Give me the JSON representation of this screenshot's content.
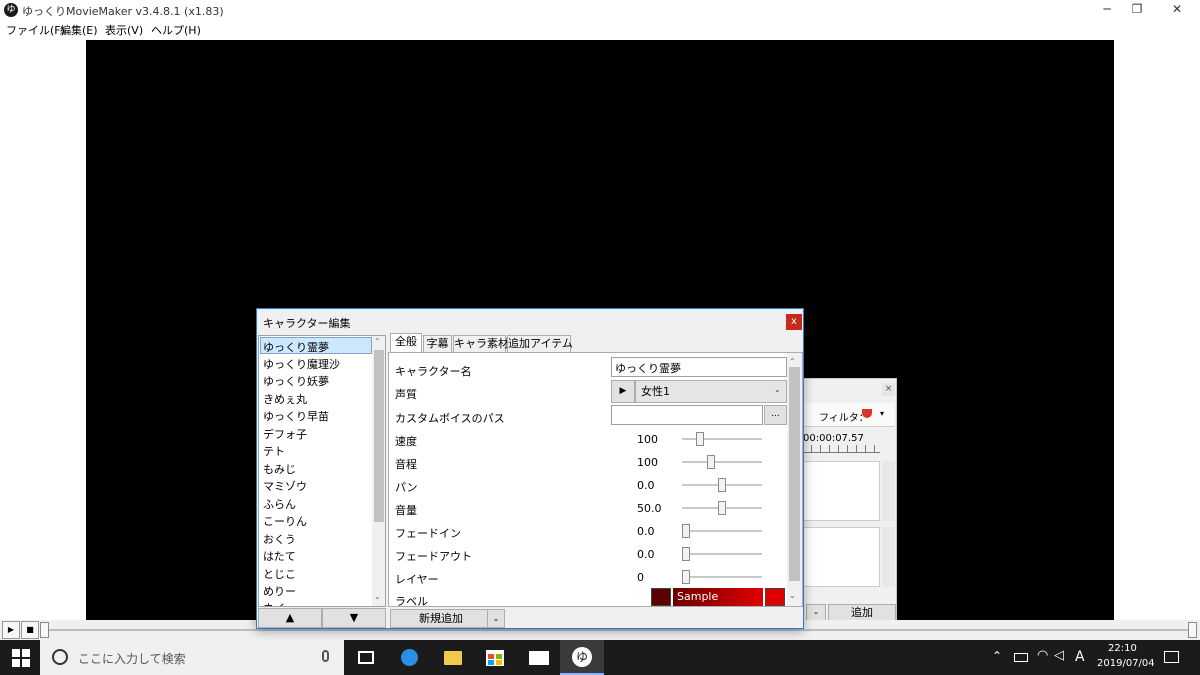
{
  "app": {
    "title": "ゆっくりMovieMaker v3.4.8.1 (x1.83)",
    "icon_glyph": "ゆ"
  },
  "window_controls": {
    "minimize": "─",
    "restore": "❐",
    "close": "✕"
  },
  "menubar": [
    "ファイル(F)",
    "編集(E)",
    "表示(V)",
    "ヘルプ(H)"
  ],
  "back_panel": {
    "close_label": "×",
    "filter_label": "フィルタ：",
    "time": "00:00:07.57",
    "minus_label": "-",
    "add_label": "追加"
  },
  "dialog": {
    "title": "キャラクター編集",
    "close_label": "x",
    "characters": [
      "ゆっくり霊夢",
      "ゆっくり魔理沙",
      "ゆっくり妖夢",
      "きめぇ丸",
      "ゆっくり早苗",
      "デフォ子",
      "テト",
      "もみじ",
      "マミゾウ",
      "ふらん",
      "こーりん",
      "おくう",
      "はたて",
      "とじこ",
      "めりー",
      "ネイ"
    ],
    "selected_index": 0,
    "up_label": "▲",
    "down_label": "▼",
    "tabs": [
      "全般",
      "字幕",
      "キャラ素材",
      "追加アイテム"
    ],
    "active_tab": 0,
    "fields": {
      "name_label": "キャラクター名",
      "name_value": "ゆっくり霊夢",
      "voice_label": "声質",
      "voice_play": "▶",
      "voice_value": "女性1",
      "custom_voice_label": "カスタムボイスのパス",
      "custom_voice_value": "",
      "browse_label": "...",
      "label_label": "ラベル",
      "label_sample": "Sample"
    },
    "sliders": [
      {
        "label": "速度",
        "value": "100",
        "level": 0.2
      },
      {
        "label": "音程",
        "value": "100",
        "level": 0.35
      },
      {
        "label": "パン",
        "value": "0.0",
        "level": 0.5
      },
      {
        "label": "音量",
        "value": "50.0",
        "level": 0.5
      },
      {
        "label": "フェードイン",
        "value": "0.0",
        "level": 0.0
      },
      {
        "label": "フェードアウト",
        "value": "0.0",
        "level": 0.0
      },
      {
        "label": "レイヤー",
        "value": "0",
        "level": 0.0
      }
    ],
    "new_add_label": "新規追加",
    "colors": {
      "dark": "#5c0000",
      "gradient_start": "#6b0000",
      "gradient_end": "#e00000",
      "bright": "#e00000"
    }
  },
  "taskbar": {
    "search_placeholder": "ここに入力して検索",
    "ime": "A",
    "time": "22:10",
    "date": "2019/07/04"
  }
}
